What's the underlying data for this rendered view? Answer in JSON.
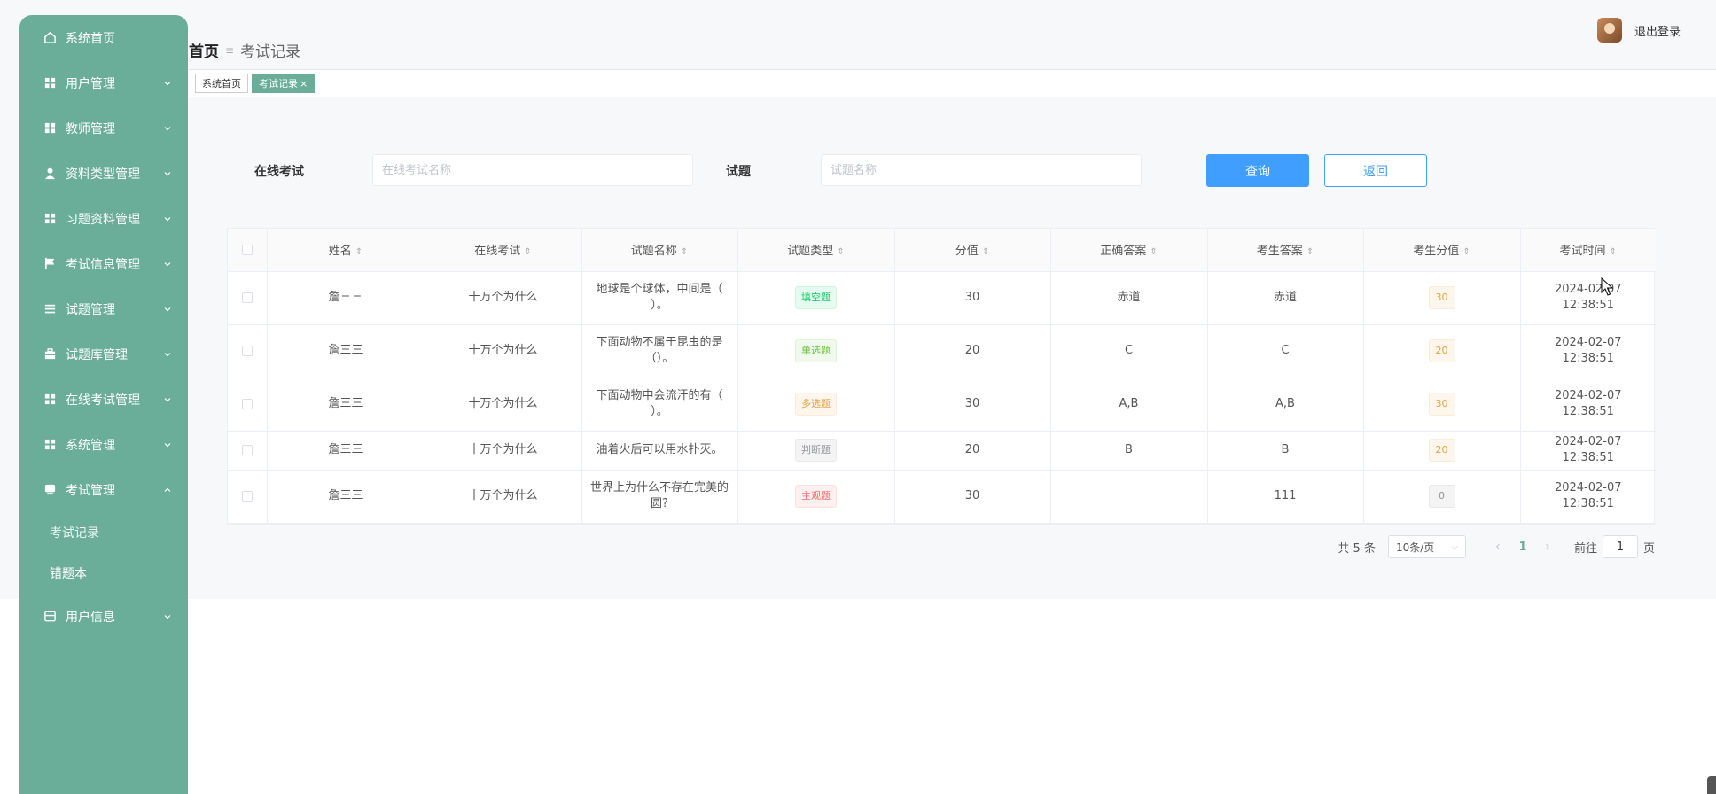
{
  "sidebar": {
    "items": [
      {
        "label": "系统首页",
        "icon": "home-icon",
        "chevron": false
      },
      {
        "label": "用户管理",
        "icon": "grid-icon",
        "chevron": "down"
      },
      {
        "label": "教师管理",
        "icon": "grid-icon",
        "chevron": "down"
      },
      {
        "label": "资料类型管理",
        "icon": "person-icon",
        "chevron": "down"
      },
      {
        "label": "习题资料管理",
        "icon": "grid-icon",
        "chevron": "down"
      },
      {
        "label": "考试信息管理",
        "icon": "flag-icon",
        "chevron": "down"
      },
      {
        "label": "试题管理",
        "icon": "list-icon",
        "chevron": "down"
      },
      {
        "label": "试题库管理",
        "icon": "briefcase-icon",
        "chevron": "down"
      },
      {
        "label": "在线考试管理",
        "icon": "grid-icon",
        "chevron": "down"
      },
      {
        "label": "系统管理",
        "icon": "grid-icon",
        "chevron": "down"
      },
      {
        "label": "考试管理",
        "icon": "chat-icon",
        "chevron": "up"
      }
    ],
    "sub_items": [
      "考试记录",
      "错题本"
    ],
    "last_item": {
      "label": "用户信息",
      "icon": "card-icon",
      "chevron": "down"
    },
    "bg_color": "#6aad98"
  },
  "header": {
    "breadcrumb_home": "首页",
    "breadcrumb_current": "考试记录",
    "logout": "退出登录"
  },
  "tabs": [
    {
      "label": "系统首页",
      "active": false
    },
    {
      "label": "考试记录",
      "active": true
    }
  ],
  "search": {
    "exam_label": "在线考试",
    "exam_placeholder": "在线考试名称",
    "question_label": "试题",
    "question_placeholder": "试题名称",
    "query_button": "查询",
    "back_button": "返回"
  },
  "table": {
    "headers": [
      "姓名",
      "在线考试",
      "试题名称",
      "试题类型",
      "分值",
      "正确答案",
      "考生答案",
      "考生分值",
      "考试时间"
    ],
    "rows": [
      {
        "name": "詹三三",
        "exam": "十万个为什么",
        "question": "地球是个球体，中间是（ ）。",
        "type": "填空题",
        "type_kind": "fill",
        "score": "30",
        "correct": "赤道",
        "answer": "赤道",
        "got": "30",
        "got_kind": "warn",
        "time": "2024-02-07 12:38:51"
      },
      {
        "name": "詹三三",
        "exam": "十万个为什么",
        "question": "下面动物不属于昆虫的是（）。",
        "type": "单选题",
        "type_kind": "single",
        "score": "20",
        "correct": "C",
        "answer": "C",
        "got": "20",
        "got_kind": "warn",
        "time": "2024-02-07 12:38:51"
      },
      {
        "name": "詹三三",
        "exam": "十万个为什么",
        "question": "下面动物中会流汗的有（ ）。",
        "type": "多选题",
        "type_kind": "multi",
        "score": "30",
        "correct": "A,B",
        "answer": "A,B",
        "got": "30",
        "got_kind": "warn",
        "time": "2024-02-07 12:38:51"
      },
      {
        "name": "詹三三",
        "exam": "十万个为什么",
        "question": "油着火后可以用水扑灭。",
        "type": "判断题",
        "type_kind": "judge",
        "score": "20",
        "correct": "B",
        "answer": "B",
        "got": "20",
        "got_kind": "warn",
        "time": "2024-02-07 12:38:51"
      },
      {
        "name": "詹三三",
        "exam": "十万个为什么",
        "question": "世界上为什么不存在完美的圆?",
        "type": "主观题",
        "type_kind": "subjective",
        "score": "30",
        "correct": "",
        "answer": "111",
        "got": "0",
        "got_kind": "info",
        "time": "2024-02-07 12:38:51"
      }
    ]
  },
  "pagination": {
    "total": "共 5 条",
    "page_size": "10条/页",
    "current_page": "1",
    "goto_prefix": "前往",
    "goto_value": "1",
    "goto_suffix": "页"
  },
  "colors": {
    "accent": "#6aad98",
    "primary": "#409eff",
    "fill": "#13ce66",
    "single": "#67c23a",
    "multi": "#e6a23c",
    "judge": "#909399",
    "subjective": "#f56c6c"
  }
}
